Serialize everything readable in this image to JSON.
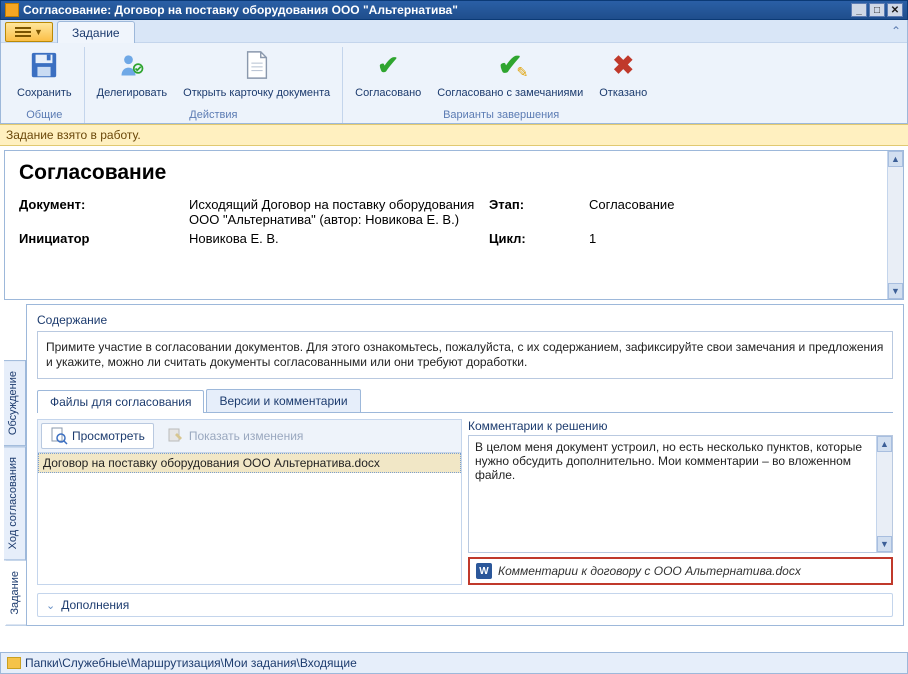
{
  "window": {
    "title": "Согласование: Договор на поставку оборудования ООО \"Альтернатива\""
  },
  "ribbon": {
    "tab": "Задание",
    "groups": {
      "common": {
        "label": "Общие",
        "save": "Сохранить"
      },
      "actions": {
        "label": "Действия",
        "delegate": "Делегировать",
        "open_card": "Открыть карточку документа"
      },
      "variants": {
        "label": "Варианты завершения",
        "approved": "Согласовано",
        "approved_notes": "Согласовано с замечаниями",
        "rejected": "Отказано"
      }
    }
  },
  "status": "Задание взято в работу.",
  "main": {
    "heading": "Согласование",
    "doc_label": "Документ:",
    "doc_value": "Исходящий Договор на поставку оборудования ООО \"Альтернатива\" (автор: Новикова Е. В.)",
    "stage_label": "Этап:",
    "stage_value": "Согласование",
    "initiator_label": "Инициатор",
    "initiator_value": "Новикова Е. В.",
    "cycle_label": "Цикл:",
    "cycle_value": "1"
  },
  "vtabs": {
    "task": "Задание",
    "flow": "Ход согласования",
    "discuss": "Обсуждение"
  },
  "content": {
    "label": "Содержание",
    "text": "Примите участие в согласовании документов. Для этого ознакомьтесь, пожалуйста, с их содержанием, зафиксируйте свои замечания и предложения и укажите, можно ли считать документы согласованными или они требуют доработки."
  },
  "htabs": {
    "files": "Файлы для согласования",
    "versions": "Версии и комментарии"
  },
  "filetools": {
    "view": "Просмотреть",
    "show_changes": "Показать изменения"
  },
  "files": {
    "row0": "Договор на поставку оборудования ООО Альтернатива.docx"
  },
  "comments": {
    "label": "Комментарии к решению",
    "text": "В целом меня документ устроил, но есть несколько пунктов, которые нужно обсудить дополнительно. Мои комментарии – во вложенном файле."
  },
  "attachment": {
    "name": "Комментарии к договору с ООО Альтернатива.docx"
  },
  "addons": "Дополнения",
  "path": "Папки\\Служебные\\Маршрутизация\\Мои задания\\Входящие"
}
